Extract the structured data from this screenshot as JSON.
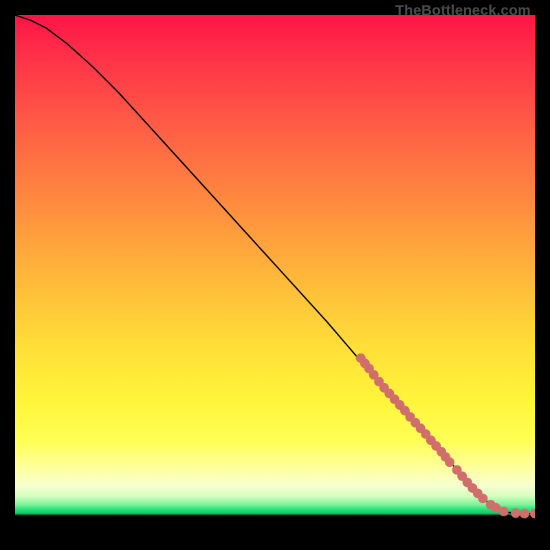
{
  "watermark": "TheBottleneck.com",
  "chart_data": {
    "type": "line",
    "title": "",
    "xlabel": "",
    "ylabel": "",
    "xlim": [
      0,
      100
    ],
    "ylim": [
      0,
      100
    ],
    "series": [
      {
        "name": "curve",
        "x": [
          0,
          3,
          6,
          10,
          15,
          20,
          30,
          40,
          50,
          60,
          66,
          70,
          74,
          78,
          82,
          85,
          88,
          90,
          92,
          95,
          98,
          100
        ],
        "y": [
          100,
          99,
          97.5,
          94.5,
          90,
          85,
          74,
          63,
          52,
          41,
          34,
          29.5,
          25,
          20.5,
          16,
          12.5,
          9,
          7,
          5.5,
          4.3,
          4.1,
          4.1
        ]
      }
    ],
    "markers": [
      {
        "x": 66.5,
        "y": 34.0
      },
      {
        "x": 67.3,
        "y": 33.0
      },
      {
        "x": 68.1,
        "y": 32.0
      },
      {
        "x": 69.0,
        "y": 30.8
      },
      {
        "x": 70.0,
        "y": 29.5
      },
      {
        "x": 71.0,
        "y": 28.3
      },
      {
        "x": 72.0,
        "y": 27.2
      },
      {
        "x": 73.0,
        "y": 26.1
      },
      {
        "x": 74.0,
        "y": 25.0
      },
      {
        "x": 75.0,
        "y": 23.9
      },
      {
        "x": 76.0,
        "y": 22.7
      },
      {
        "x": 77.0,
        "y": 21.6
      },
      {
        "x": 78.0,
        "y": 20.5
      },
      {
        "x": 79.0,
        "y": 19.4
      },
      {
        "x": 80.0,
        "y": 18.2
      },
      {
        "x": 81.0,
        "y": 17.1
      },
      {
        "x": 82.0,
        "y": 16.0
      },
      {
        "x": 82.8,
        "y": 15.0
      },
      {
        "x": 83.6,
        "y": 14.0
      },
      {
        "x": 85.0,
        "y": 12.5
      },
      {
        "x": 86.0,
        "y": 11.3
      },
      {
        "x": 87.0,
        "y": 10.1
      },
      {
        "x": 88.0,
        "y": 9.0
      },
      {
        "x": 89.0,
        "y": 8.0
      },
      {
        "x": 90.0,
        "y": 7.0
      },
      {
        "x": 91.5,
        "y": 5.8
      },
      {
        "x": 92.5,
        "y": 5.2
      },
      {
        "x": 94.0,
        "y": 4.5
      },
      {
        "x": 96.3,
        "y": 4.2
      },
      {
        "x": 98.0,
        "y": 4.1
      },
      {
        "x": 100.0,
        "y": 4.1
      }
    ],
    "colors": {
      "curve": "#000000",
      "marker_fill": "#cf6e6b",
      "marker_stroke": "#b85a57"
    }
  }
}
